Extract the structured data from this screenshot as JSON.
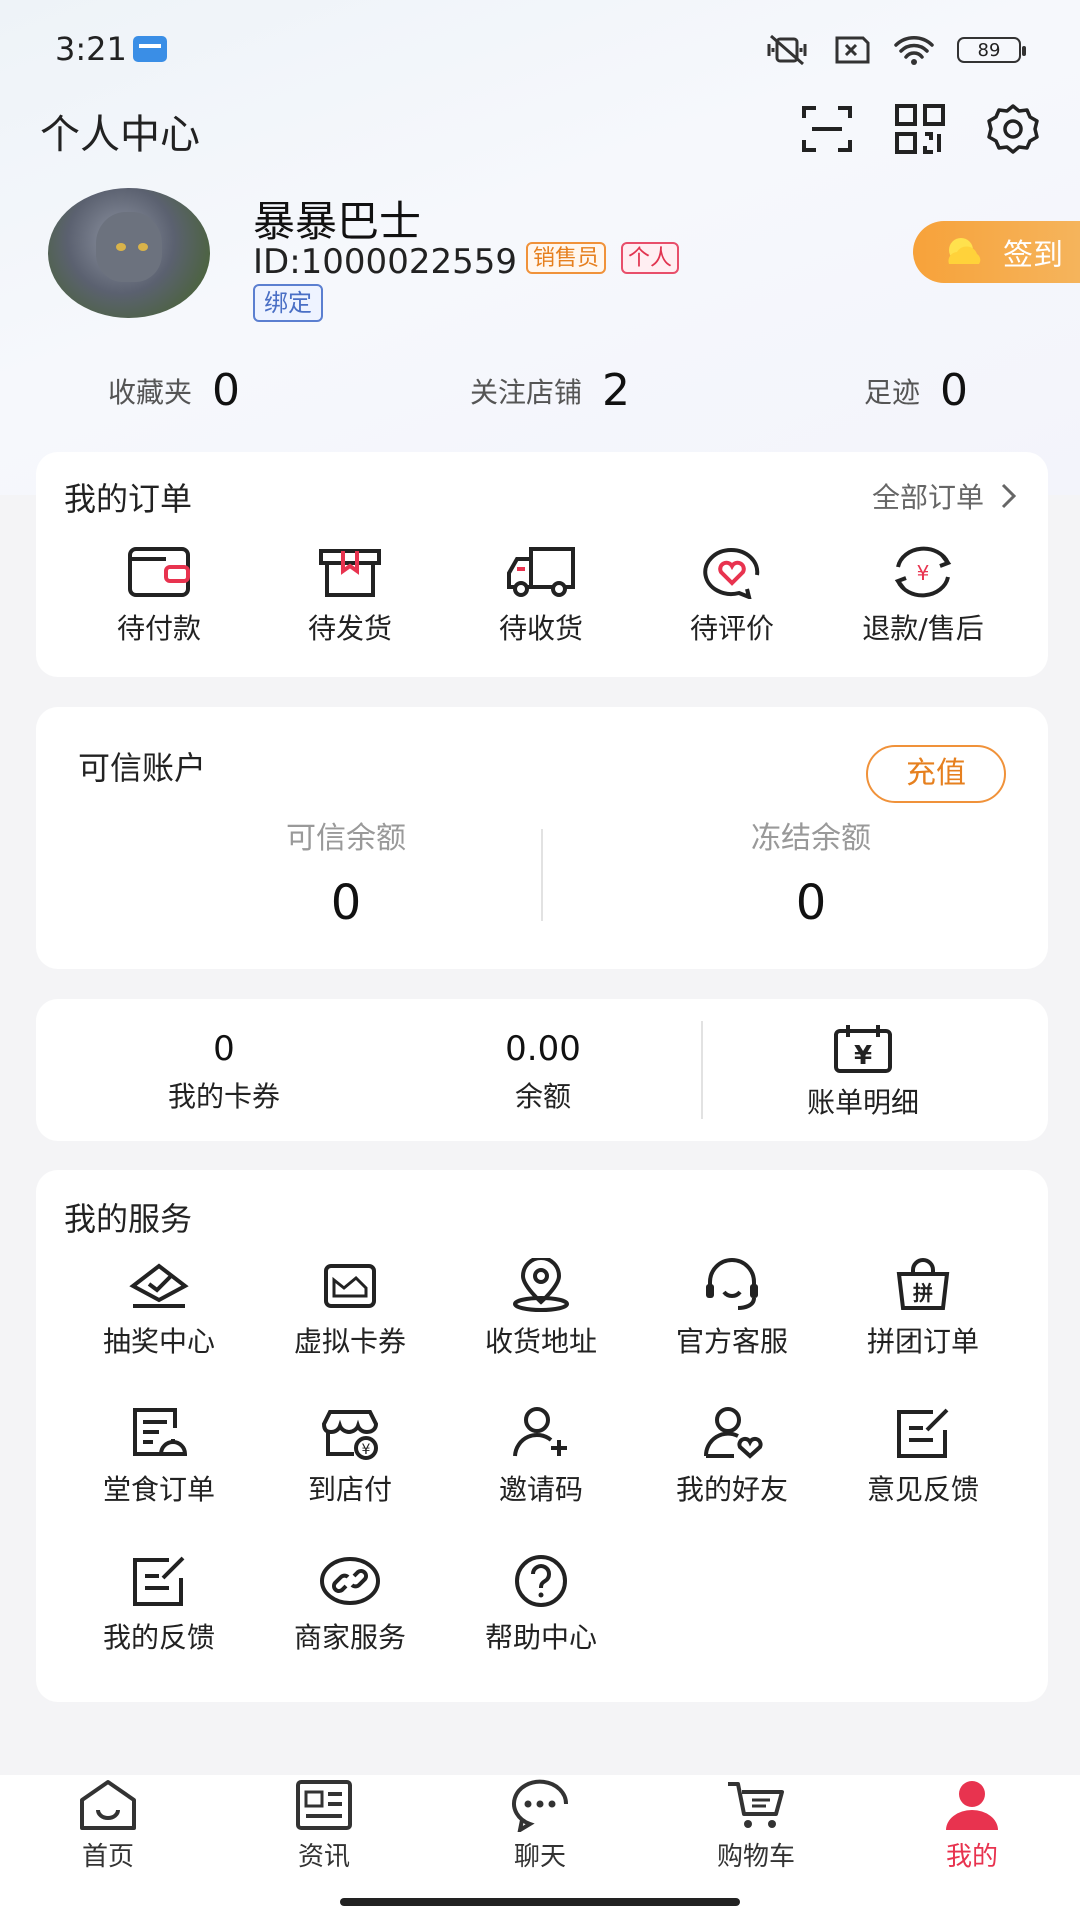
{
  "status_bar": {
    "time": "3:21",
    "battery": "89"
  },
  "header": {
    "title": "个人中心",
    "icons": [
      "scan-icon",
      "qr-code-icon",
      "settings-icon"
    ]
  },
  "profile": {
    "name": "暴暴巴士",
    "id": "ID:1000022559",
    "tags": {
      "sales": "销售员",
      "personal": "个人"
    },
    "bind_label": "绑定",
    "signin_label": "签到"
  },
  "stats": [
    {
      "label": "收藏夹",
      "value": "0"
    },
    {
      "label": "关注店铺",
      "value": "2"
    },
    {
      "label": "足迹",
      "value": "0"
    }
  ],
  "orders": {
    "title": "我的订单",
    "all_label": "全部订单",
    "items": [
      {
        "label": "待付款",
        "icon": "wallet-icon"
      },
      {
        "label": "待发货",
        "icon": "package-icon"
      },
      {
        "label": "待收货",
        "icon": "truck-icon"
      },
      {
        "label": "待评价",
        "icon": "heart-chat-icon"
      },
      {
        "label": "退款/售后",
        "icon": "refund-icon"
      }
    ]
  },
  "credit_account": {
    "title": "可信账户",
    "recharge_label": "充值",
    "available_label": "可信余额",
    "available_value": "0",
    "frozen_label": "冻结余额",
    "frozen_value": "0"
  },
  "wallet": {
    "coupons_value": "0",
    "coupons_label": "我的卡券",
    "balance_value": "0.00",
    "balance_label": "余额",
    "bill_label": "账单明细"
  },
  "services": {
    "title": "我的服务",
    "items": [
      {
        "label": "抽奖中心",
        "icon": "lottery-icon"
      },
      {
        "label": "虚拟卡券",
        "icon": "virtual-card-icon"
      },
      {
        "label": "收货地址",
        "icon": "location-icon"
      },
      {
        "label": "官方客服",
        "icon": "headset-icon"
      },
      {
        "label": "拼团订单",
        "icon": "group-bag-icon"
      },
      {
        "label": "堂食订单",
        "icon": "dine-in-icon"
      },
      {
        "label": "到店付",
        "icon": "store-pay-icon"
      },
      {
        "label": "邀请码",
        "icon": "add-user-icon"
      },
      {
        "label": "我的好友",
        "icon": "friend-icon"
      },
      {
        "label": "意见反馈",
        "icon": "feedback-icon"
      },
      {
        "label": "我的反馈",
        "icon": "my-feedback-icon"
      },
      {
        "label": "商家服务",
        "icon": "merchant-icon"
      },
      {
        "label": "帮助中心",
        "icon": "help-icon"
      }
    ]
  },
  "tabbar": {
    "items": [
      {
        "label": "首页",
        "icon": "home-icon"
      },
      {
        "label": "资讯",
        "icon": "news-icon"
      },
      {
        "label": "聊天",
        "icon": "chat-icon"
      },
      {
        "label": "购物车",
        "icon": "cart-icon"
      },
      {
        "label": "我的",
        "icon": "profile-icon"
      }
    ],
    "active_color": "#e8334f"
  },
  "colors": {
    "accent": "#e8334f",
    "orange": "#f0923a"
  }
}
